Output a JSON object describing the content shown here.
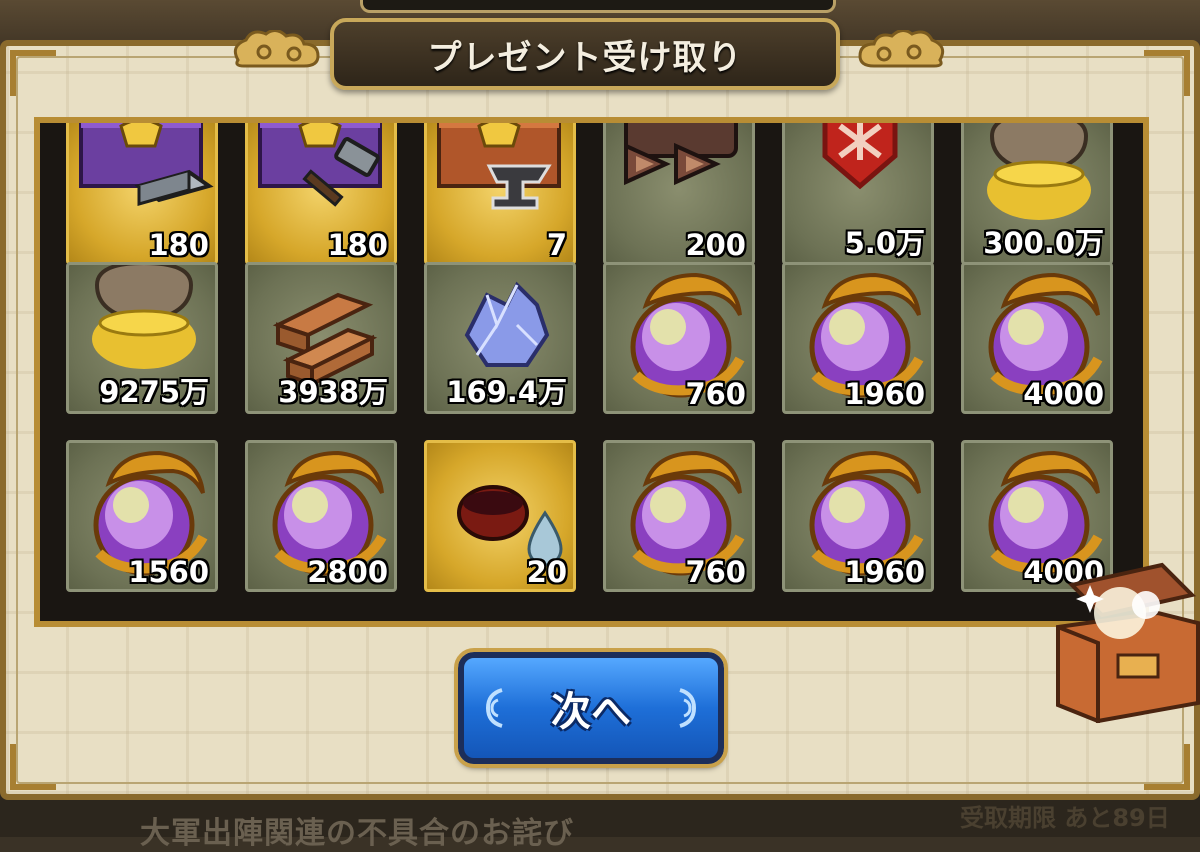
{
  "title": "プレゼント受け取り",
  "next_button": "次へ",
  "background_notice": "大軍出陣関連の不具合のお詫び",
  "background_deadline": "受取期限 あと89日",
  "items": [
    {
      "icon": "purple-chest-ingot-icon",
      "qty": "180",
      "frame": "gold"
    },
    {
      "icon": "purple-chest-hammer-icon",
      "qty": "180",
      "frame": "gold"
    },
    {
      "icon": "wooden-chest-anvil-icon",
      "qty": "7",
      "frame": "gold"
    },
    {
      "icon": "speed-arrows-icon",
      "qty": "200",
      "frame": "green"
    },
    {
      "icon": "red-crest-badge-icon",
      "qty": "5.0万",
      "frame": "green"
    },
    {
      "icon": "gold-pot-icon",
      "qty": "300.0万",
      "frame": "green"
    },
    {
      "icon": "gold-pot-icon",
      "qty": "9275万",
      "frame": "green"
    },
    {
      "icon": "wood-planks-icon",
      "qty": "3938万",
      "frame": "green"
    },
    {
      "icon": "blue-crystal-icon",
      "qty": "169.4万",
      "frame": "green"
    },
    {
      "icon": "dragon-orb-icon",
      "qty": "760",
      "frame": "green"
    },
    {
      "icon": "dragon-orb-icon",
      "qty": "1960",
      "frame": "green"
    },
    {
      "icon": "dragon-orb-icon",
      "qty": "4000",
      "frame": "green"
    },
    {
      "icon": "dragon-orb-icon",
      "qty": "1560",
      "frame": "green"
    },
    {
      "icon": "dragon-orb-icon",
      "qty": "2800",
      "frame": "green"
    },
    {
      "icon": "sake-cup-drop-icon",
      "qty": "20",
      "frame": "gold"
    },
    {
      "icon": "dragon-orb-icon",
      "qty": "760",
      "frame": "green"
    },
    {
      "icon": "dragon-orb-icon",
      "qty": "1960",
      "frame": "green"
    },
    {
      "icon": "dragon-orb-icon",
      "qty": "4000",
      "frame": "green"
    }
  ],
  "colors": {
    "accent_gold": "#c8a85a",
    "button_blue": "#1e6fd8",
    "tile_green": "#6d7255"
  }
}
